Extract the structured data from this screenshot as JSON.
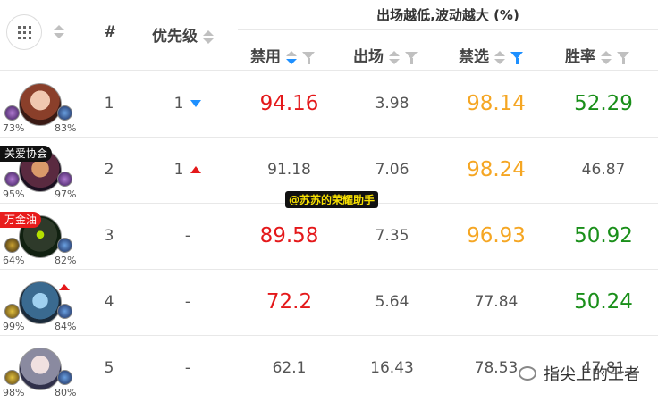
{
  "header": {
    "rank_label": "#",
    "priority_label": "优先级",
    "group_title": "出场越低,波动越大 (%)",
    "ban_label": "禁用",
    "appear_label": "出场",
    "banpick_label": "禁选",
    "winrate_label": "胜率"
  },
  "colors": {
    "red": "#e4181a",
    "orange": "#f5a623",
    "green": "#1a8f1a",
    "active": "#1e90ff"
  },
  "rows": [
    {
      "rank": "1",
      "priority": "1",
      "trend": "down",
      "tag": "",
      "skill_left_pct": "73%",
      "skill_right_pct": "83%",
      "ban": "94.16",
      "appear": "3.98",
      "banpick": "98.14",
      "winrate": "52.29"
    },
    {
      "rank": "2",
      "priority": "1",
      "trend": "up",
      "tag": "关爱协会",
      "skill_left_pct": "95%",
      "skill_right_pct": "97%",
      "ban": "91.18",
      "appear": "7.06",
      "banpick": "98.24",
      "winrate": "46.87"
    },
    {
      "rank": "3",
      "priority": "-",
      "trend": "",
      "tag": "万金油",
      "skill_left_pct": "64%",
      "skill_right_pct": "82%",
      "ban": "89.58",
      "appear": "7.35",
      "banpick": "96.93",
      "winrate": "50.92"
    },
    {
      "rank": "4",
      "priority": "-",
      "trend": "",
      "tag": "",
      "skill_left_pct": "99%",
      "skill_right_pct": "84%",
      "ban": "72.2",
      "appear": "5.64",
      "banpick": "77.84",
      "winrate": "50.24"
    },
    {
      "rank": "5",
      "priority": "-",
      "trend": "",
      "tag": "",
      "skill_left_pct": "98%",
      "skill_right_pct": "80%",
      "ban": "62.1",
      "appear": "16.43",
      "banpick": "78.53",
      "winrate": "47.81"
    }
  ],
  "watermark": "@苏苏的荣耀助手",
  "wechat_label": "指尖上的王者"
}
